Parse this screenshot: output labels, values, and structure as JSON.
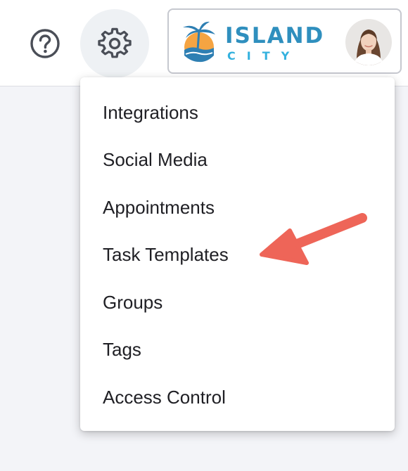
{
  "header": {
    "help": {
      "icon": "help-circle-icon"
    },
    "settings": {
      "icon": "gear-icon"
    },
    "brand": {
      "name": "ISLAND",
      "sub": "CITY",
      "colors": {
        "primary": "#2f8fbe",
        "secondary": "#33b1de",
        "sun": "#f5a442",
        "palm": "#2e7fb3"
      }
    },
    "avatar": {
      "icon": "user-avatar"
    }
  },
  "settings_menu": {
    "items": [
      {
        "label": "Integrations"
      },
      {
        "label": "Social Media"
      },
      {
        "label": "Appointments"
      },
      {
        "label": "Task Templates"
      },
      {
        "label": "Groups"
      },
      {
        "label": "Tags"
      },
      {
        "label": "Access Control"
      }
    ]
  },
  "annotation": {
    "arrow_color": "#ee6558",
    "points_to": "Task Templates"
  }
}
